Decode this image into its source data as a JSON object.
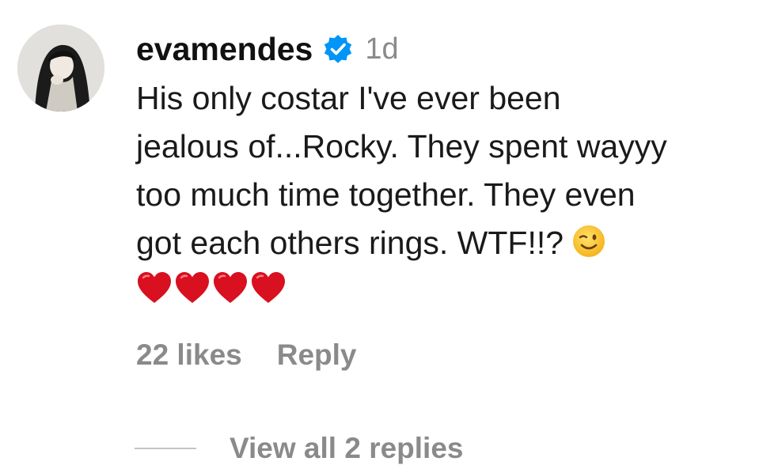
{
  "comment": {
    "username": "evamendes",
    "verified_icon": "verified-badge-icon",
    "timestamp": "1d",
    "text_lines": [
      "His only costar I've ever been",
      "jealous of...Rocky. They spent wayyy",
      "too much time together. They even",
      "got each others rings. WTF!!?"
    ],
    "emoji": "winking-face-icon",
    "hearts": [
      "red-heart-icon",
      "red-heart-icon",
      "red-heart-icon",
      "red-heart-icon"
    ],
    "likes_label": "22 likes",
    "reply_label": "Reply",
    "view_replies_label": "View all 2 replies"
  },
  "colors": {
    "verified_blue": "#0095f6",
    "muted_text": "#8a8a8a",
    "heart_red": "#d8101f"
  }
}
